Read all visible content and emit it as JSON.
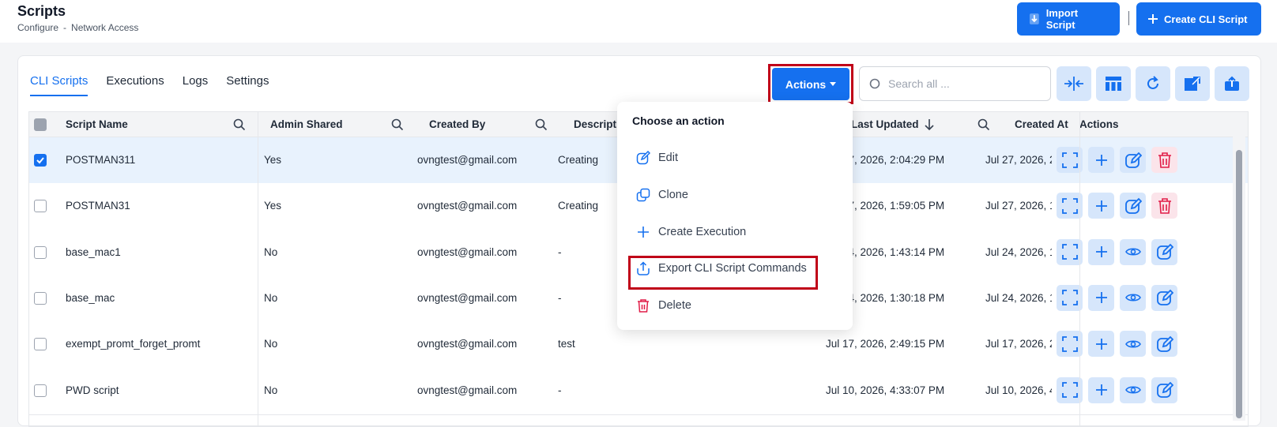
{
  "header": {
    "title": "Scripts",
    "breadcrumb": [
      "Configure",
      "-",
      "Network Access"
    ],
    "import_label": "Import Script",
    "create_label": "Create CLI Script"
  },
  "tabs": [
    "CLI Scripts",
    "Executions",
    "Logs",
    "Settings"
  ],
  "toolbar": {
    "actions_label": "Actions",
    "search_placeholder": "Search all ..."
  },
  "table": {
    "columns": [
      "Script Name",
      "Admin Shared",
      "Created By",
      "Descripti",
      "Last Updated",
      "Created At",
      "Actions"
    ],
    "rows": [
      {
        "name": "POSTMAN311",
        "shared": "Yes",
        "created_by": "ovngtest@gmail.com",
        "description": "Creating",
        "last_updated": "Jul 27, 2026, 2:04:29 PM",
        "created_at": "Jul 27, 2026, 2",
        "checked": true,
        "actions": [
          "expand-icon",
          "plus-icon",
          "edit-icon",
          "trash-icon"
        ]
      },
      {
        "name": "POSTMAN31",
        "shared": "Yes",
        "created_by": "ovngtest@gmail.com",
        "description": "Creating",
        "last_updated": "Jul 27, 2026, 1:59:05 PM",
        "created_at": "Jul 27, 2026, 1",
        "checked": false,
        "actions": [
          "expand-icon",
          "plus-icon",
          "edit-icon",
          "trash-icon"
        ]
      },
      {
        "name": "base_mac1",
        "shared": "No",
        "created_by": "ovngtest@gmail.com",
        "description": "-",
        "last_updated": "Jul 24, 2026, 1:43:14 PM",
        "created_at": "Jul 24, 2026, 1",
        "checked": false,
        "actions": [
          "expand-icon",
          "plus-icon",
          "eye-icon",
          "edit-icon"
        ]
      },
      {
        "name": "base_mac",
        "shared": "No",
        "created_by": "ovngtest@gmail.com",
        "description": "-",
        "last_updated": "Jul 24, 2026, 1:30:18 PM",
        "created_at": "Jul 24, 2026, 1",
        "checked": false,
        "actions": [
          "expand-icon",
          "plus-icon",
          "eye-icon",
          "edit-icon"
        ]
      },
      {
        "name": "exempt_promt_forget_promt",
        "shared": "No",
        "created_by": "ovngtest@gmail.com",
        "description": "test",
        "last_updated": "Jul 17, 2026, 2:49:15 PM",
        "created_at": "Jul 17, 2026, 2",
        "checked": false,
        "actions": [
          "expand-icon",
          "plus-icon",
          "eye-icon",
          "edit-icon"
        ]
      },
      {
        "name": "PWD script",
        "shared": "No",
        "created_by": "ovngtest@gmail.com",
        "description": "-",
        "last_updated": "Jul 10, 2026, 4:33:07 PM",
        "created_at": "Jul 10, 2026, 4",
        "checked": false,
        "actions": [
          "expand-icon",
          "plus-icon",
          "eye-icon",
          "edit-icon"
        ]
      }
    ]
  },
  "menu": {
    "title": "Choose an action",
    "items": [
      "Edit",
      "Clone",
      "Create Execution",
      "Export CLI Script Commands",
      "Delete"
    ]
  },
  "colors": {
    "primary": "#1570ef",
    "highlight": "#c00018",
    "selected_row": "#e8f2fd",
    "danger": "#e11d48"
  }
}
